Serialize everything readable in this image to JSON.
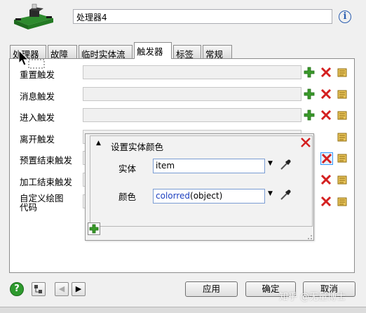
{
  "header": {
    "name_value": "处理器4",
    "info_icon": "info-icon"
  },
  "tabs": [
    {
      "label": "处理器"
    },
    {
      "label": "故障"
    },
    {
      "label": "临时实体流"
    },
    {
      "label": "触发器",
      "active": true
    },
    {
      "label": "标签"
    },
    {
      "label": "常规"
    }
  ],
  "triggers": [
    {
      "label": "重置触发"
    },
    {
      "label": "消息触发"
    },
    {
      "label": "进入触发"
    },
    {
      "label": "离开触发"
    },
    {
      "label": "预置结束触发"
    },
    {
      "label": "加工结束触发"
    },
    {
      "label": "自定义绘图\n代码"
    }
  ],
  "popup": {
    "title": "设置实体颜色",
    "entity_label": "实体",
    "entity_value": "item",
    "color_label": "颜色",
    "color_func": "colorred",
    "color_arg": "(object)"
  },
  "footer": {
    "apply": "应用",
    "ok": "确定",
    "cancel": "取消"
  },
  "watermark": "知乎 @无量博士",
  "colors": {
    "add": "#3a9a2a",
    "delete": "#d42020",
    "edit": "#c9a12a",
    "link": "#2a5db0"
  }
}
